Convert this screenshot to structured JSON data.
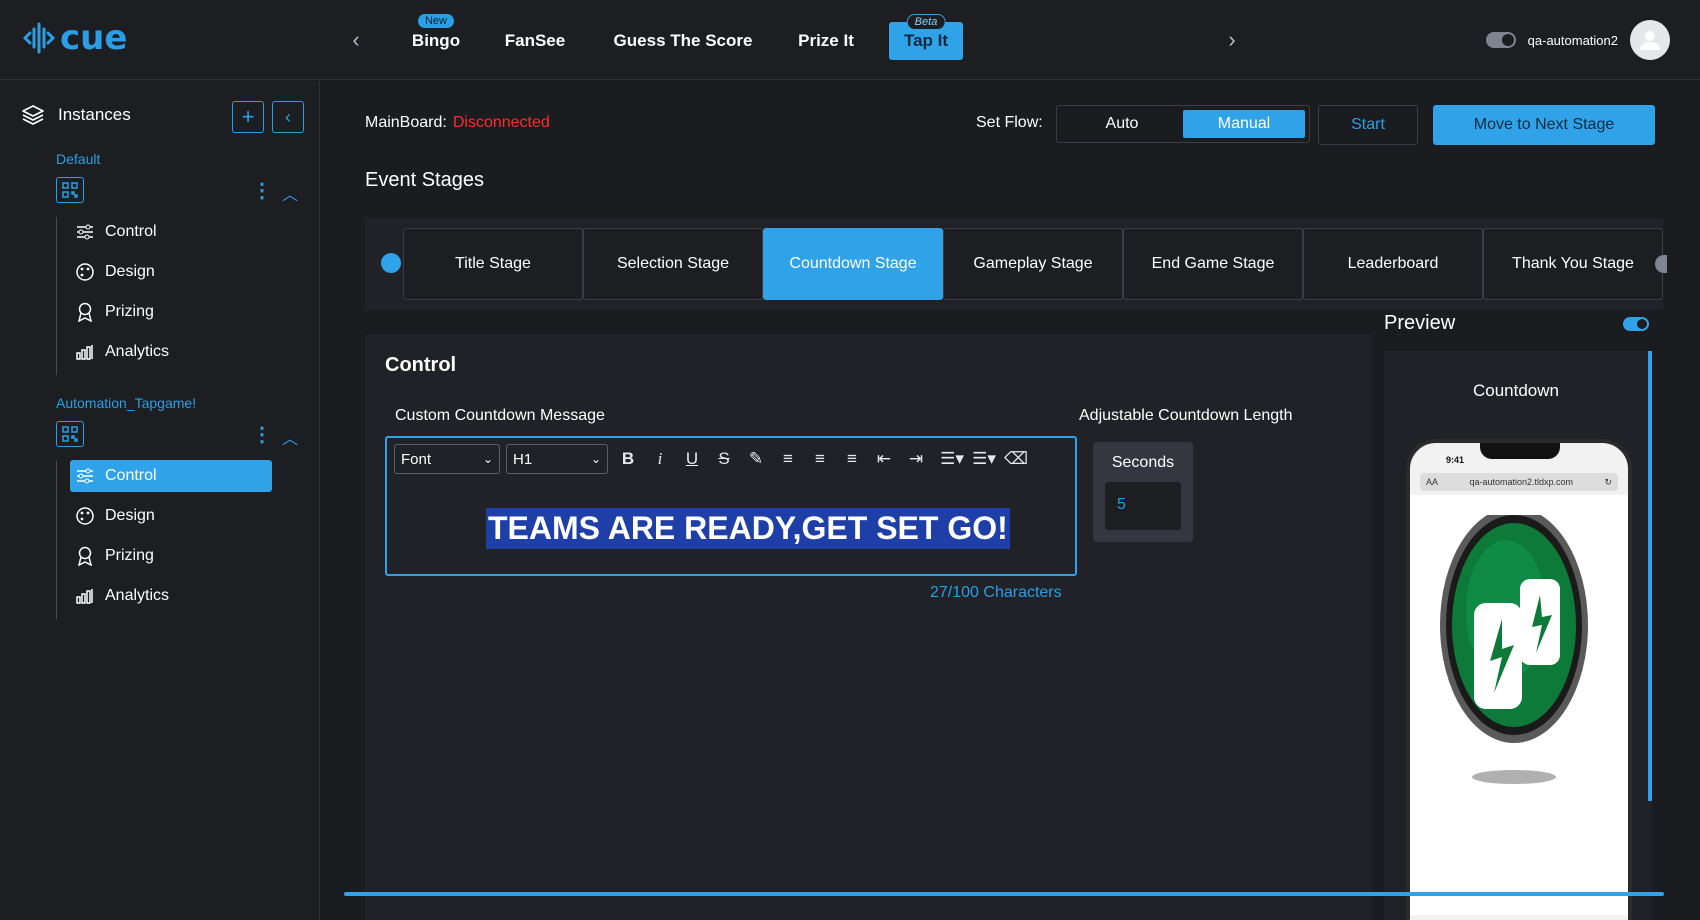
{
  "app": {
    "logo_text": "cue"
  },
  "nav": {
    "tabs": [
      {
        "label": "Bingo",
        "badge": "New"
      },
      {
        "label": "FanSee"
      },
      {
        "label": "Guess The Score"
      },
      {
        "label": "Prize It"
      },
      {
        "label": "Tap It",
        "badge": "Beta",
        "active": true
      }
    ]
  },
  "user": {
    "name": "qa-automation2"
  },
  "sidebar": {
    "title": "Instances",
    "groups": [
      {
        "name": "Default",
        "items": [
          "Control",
          "Design",
          "Prizing",
          "Analytics"
        ]
      },
      {
        "name": "Automation_Tapgame!",
        "items": [
          "Control",
          "Design",
          "Prizing",
          "Analytics"
        ],
        "active_item": "Control"
      }
    ]
  },
  "main": {
    "mainboard_label": "MainBoard:",
    "mainboard_status": "Disconnected",
    "set_flow_label": "Set Flow:",
    "flow_options": [
      "Auto",
      "Manual"
    ],
    "flow_selected": "Manual",
    "start_label": "Start",
    "next_stage_label": "Move to Next Stage",
    "event_stages_title": "Event Stages",
    "stages": [
      "Title Stage",
      "Selection Stage",
      "Countdown Stage",
      "Gameplay Stage",
      "End Game Stage",
      "Leaderboard",
      "Thank You Stage"
    ],
    "active_stage": "Countdown Stage"
  },
  "control": {
    "title": "Control",
    "message_label": "Custom Countdown Message",
    "font_select": "Font",
    "heading_select": "H1",
    "message_text": "TEAMS ARE READY,GET SET GO!",
    "char_count": "27/100 Characters",
    "length_label": "Adjustable Countdown Length",
    "seconds_label": "Seconds",
    "seconds_value": "5"
  },
  "preview": {
    "title": "Preview",
    "enabled": true,
    "screen_label": "Countdown",
    "phone_time": "9:41",
    "phone_url": "qa-automation2.tldxp.com",
    "phone_aa": "AA"
  },
  "colors": {
    "accent": "#2fa2e8",
    "error": "#ff2a2a",
    "background": "#1b1c1f"
  }
}
